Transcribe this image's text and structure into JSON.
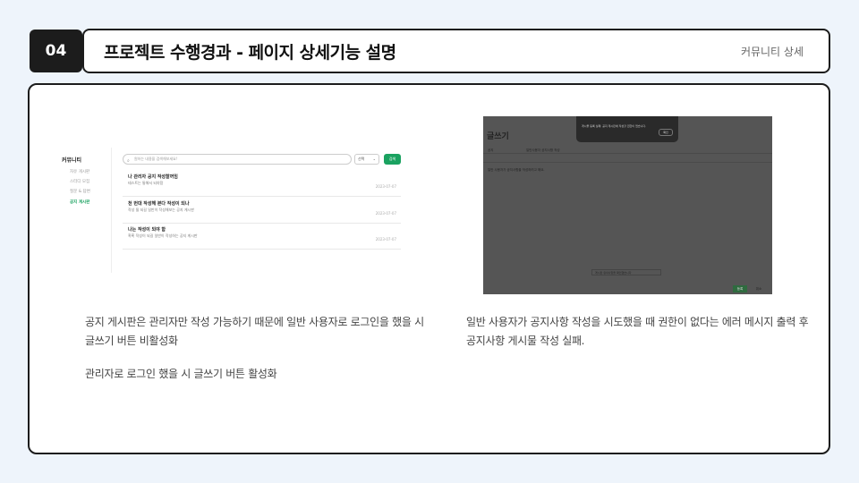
{
  "header": {
    "number": "04",
    "title": "프로젝트 수행경과 - 페이지 상세기능 설명",
    "section": "커뮤니티 상세"
  },
  "left_screenshot": {
    "sidebar_title": "커뮤니티",
    "sidebar_items": [
      "자유 게시판",
      "스터디 모집",
      "질문 & 답변",
      "공지 게시판"
    ],
    "active_item": "공지 게시판",
    "search_placeholder": "원하는 내용을 검색해보세요!",
    "select_value": "선택",
    "search_button": "검색",
    "posts": [
      {
        "title": "나 관리자 공지 작성할꺼임",
        "body": "테스트는 통해서 되야함",
        "date": "2023-07-07"
      },
      {
        "title": "천 번대 작성해 본다 작성이 되나",
        "body": "작성 될 되길 일반이 작성해보는 공지 게시판",
        "date": "2023-07-07"
      },
      {
        "title": "나는 작성이 되야 함",
        "body": "혹혹 작성이 되길 일반이 작성하는 공지 게시판",
        "date": "2023-07-07"
      }
    ]
  },
  "right_screenshot": {
    "page_title": "글쓰기",
    "board_label": "공지",
    "title_value": "일반사용자 공지사항 작성",
    "content_text": "일반 사용자가 공지사항을 작성하려고 해요.",
    "modal_text": "게시물 등록 실패: 공지 게시판에 작성할 권한이 없습니다.",
    "modal_button": "확인",
    "save_button": "등록",
    "cancel_button": "취소",
    "checkbox_text": "게시판 유의사항을 확인했습니다"
  },
  "descriptions": {
    "left_line1": "공지 게시판은 관리자만 작성 가능하기 때문에 일반 사용자로 로그인을 했을 시",
    "left_line2": "글쓰기 버튼 비활성화",
    "left_line3": "관리자로 로그인 했을 시 글쓰기 버튼 활성화",
    "right_line1": "일반 사용자가 공지사항 작성을 시도했을 때 권한이 없다는 에러 메시지 출력 후",
    "right_line2": "공지사항 게시물 작성 실패."
  }
}
